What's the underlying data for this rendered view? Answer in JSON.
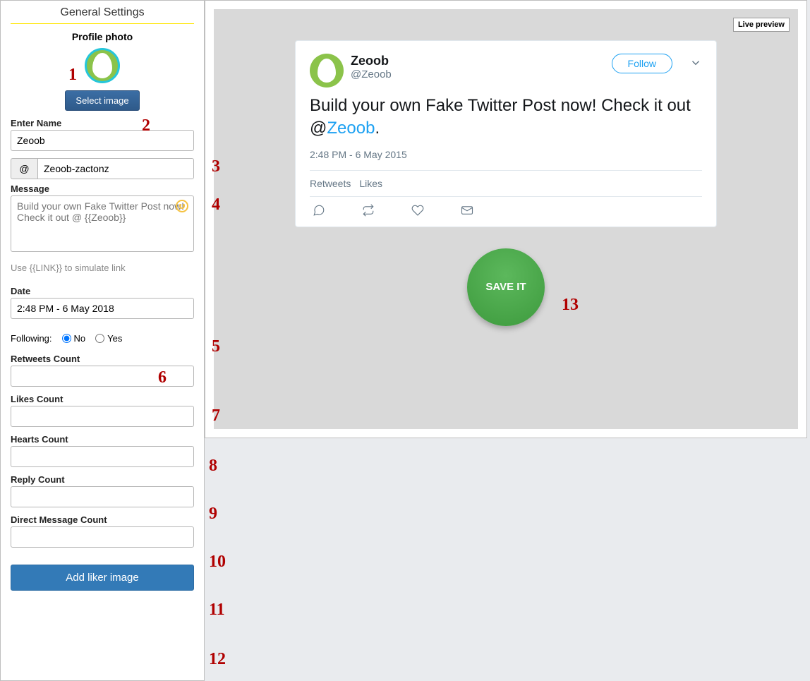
{
  "sidebar": {
    "title": "General Settings",
    "profile_photo_label": "Profile photo",
    "select_image_label": "Select image",
    "name_label": "Enter Name",
    "name_value": "Zeoob",
    "username_prefix": "@",
    "username_value": "Zeoob-zactonz",
    "message_label": "Message",
    "message_placeholder": "Build your own Fake Twitter Post now! Check it out @ {{Zeoob}}",
    "link_hint": "Use {{LINK}} to simulate link",
    "date_label": "Date",
    "date_value": "2:48 PM - 6 May 2018",
    "following_label": "Following:",
    "following_no": "No",
    "following_yes": "Yes",
    "retweets_label": "Retweets Count",
    "likes_label": "Likes Count",
    "hearts_label": "Hearts Count",
    "reply_label": "Reply Count",
    "dm_label": "Direct Message Count",
    "add_liker_label": "Add liker image"
  },
  "preview": {
    "live_preview_label": "Live preview",
    "tweet": {
      "name": "Zeoob",
      "handle": "@Zeoob",
      "follow_label": "Follow",
      "text_prefix": "Build your own Fake Twitter Post now! Check it out @",
      "mention": "Zeoob",
      "text_suffix": ".",
      "timestamp": "2:48 PM - 6 May 2015",
      "retweets_label": "Retweets",
      "likes_label": "Likes"
    },
    "save_label": "SAVE IT"
  },
  "annotations": {
    "a1": "1",
    "a2": "2",
    "a3": "3",
    "a4": "4",
    "a5": "5",
    "a6": "6",
    "a7": "7",
    "a8": "8",
    "a9": "9",
    "a10": "10",
    "a11": "11",
    "a12": "12",
    "a13": "13"
  }
}
